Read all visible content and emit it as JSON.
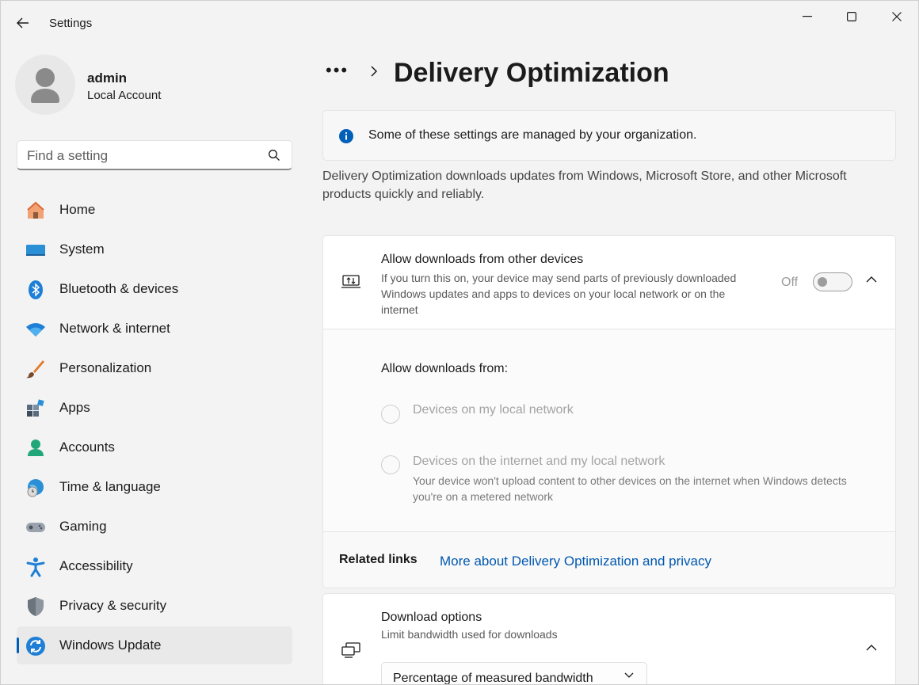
{
  "window": {
    "title": "Settings"
  },
  "user": {
    "name": "admin",
    "account_type": "Local Account"
  },
  "search": {
    "placeholder": "Find a setting"
  },
  "nav": {
    "items": [
      {
        "label": "Home",
        "icon": "home-icon"
      },
      {
        "label": "System",
        "icon": "system-icon"
      },
      {
        "label": "Bluetooth & devices",
        "icon": "bluetooth-icon"
      },
      {
        "label": "Network & internet",
        "icon": "wifi-icon"
      },
      {
        "label": "Personalization",
        "icon": "brush-icon"
      },
      {
        "label": "Apps",
        "icon": "apps-icon"
      },
      {
        "label": "Accounts",
        "icon": "accounts-icon"
      },
      {
        "label": "Time & language",
        "icon": "globe-clock-icon"
      },
      {
        "label": "Gaming",
        "icon": "gamepad-icon"
      },
      {
        "label": "Accessibility",
        "icon": "accessibility-icon"
      },
      {
        "label": "Privacy & security",
        "icon": "shield-icon"
      },
      {
        "label": "Windows Update",
        "icon": "update-icon"
      }
    ],
    "active": "Windows Update"
  },
  "breadcrumb": {
    "overflow": "•••",
    "current": "Delivery Optimization"
  },
  "info_bar": {
    "text": "Some of these settings are managed by your organization."
  },
  "description": "Delivery Optimization downloads updates from Windows, Microsoft Store, and other Microsoft products quickly and reliably.",
  "allow_downloads": {
    "title": "Allow downloads from other devices",
    "description": "If you turn this on, your device may send parts of previously downloaded Windows updates and apps to devices on your local network or on the internet",
    "toggle_label": "Off",
    "toggle_on": false,
    "sub_title": "Allow downloads from:",
    "options": [
      {
        "label": "Devices on my local network",
        "description": ""
      },
      {
        "label": "Devices on the internet and my local network",
        "description": "Your device won't upload content to other devices on the internet when Windows detects you're on a metered network"
      }
    ]
  },
  "related_links": {
    "label": "Related links",
    "link": "More about Delivery Optimization and privacy"
  },
  "download_options": {
    "title": "Download options",
    "description": "Limit bandwidth used for downloads",
    "dropdown_value": "Percentage of measured bandwidth"
  },
  "colors": {
    "accent": "#005fb8",
    "link": "#0058b0"
  }
}
